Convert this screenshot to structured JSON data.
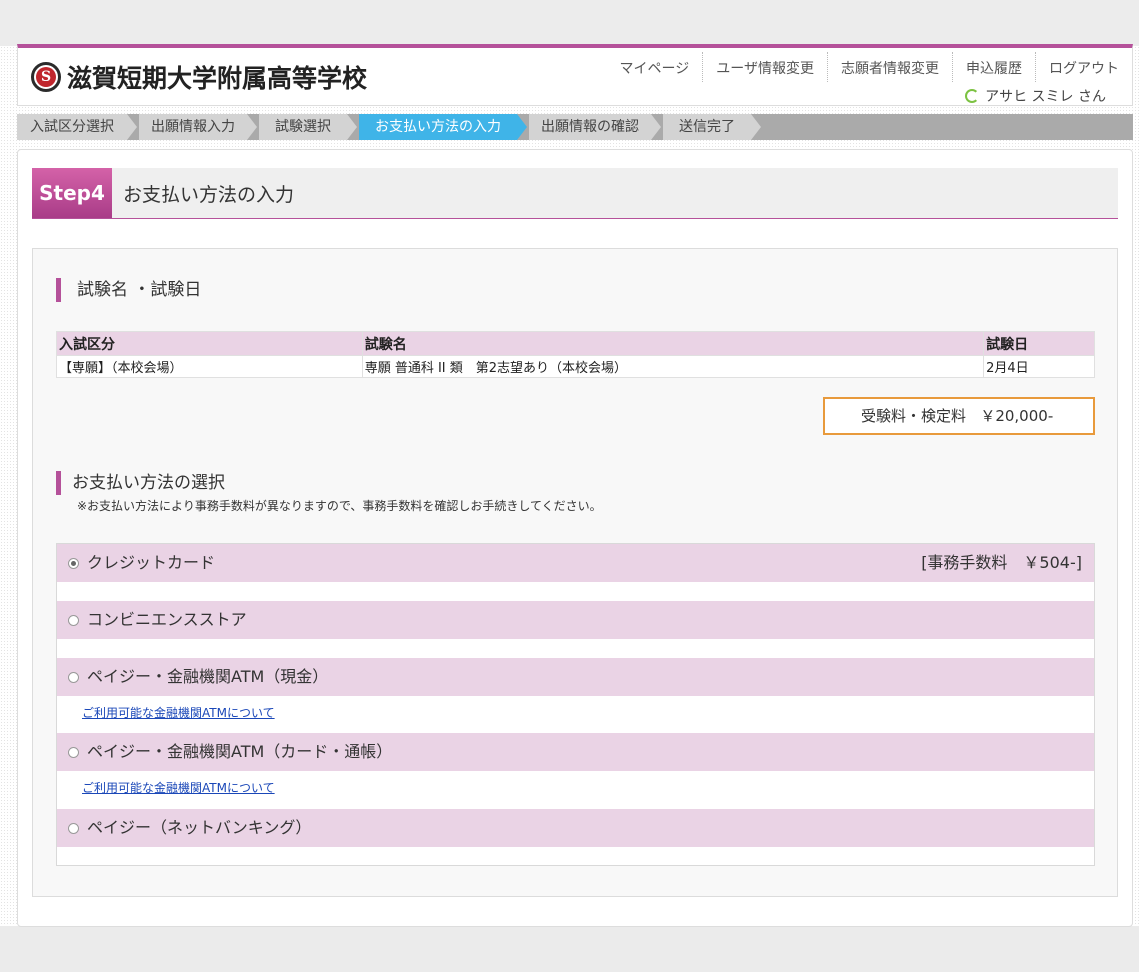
{
  "school": {
    "name": "滋賀短期大学附属高等学校",
    "logo_letter": "S"
  },
  "topnav": [
    "マイページ",
    "ユーザ情報変更",
    "志願者情報変更",
    "申込履歴",
    "ログアウト"
  ],
  "user": {
    "name": "アサヒ スミレ さん"
  },
  "steps": [
    "入試区分選択",
    "出願情報入力",
    "試験選択",
    "お支払い方法の入力",
    "出願情報の確認",
    "送信完了"
  ],
  "active_step": 3,
  "step_header": {
    "badge": "Step4",
    "title": "お支払い方法の入力"
  },
  "exam_section": {
    "title": "試験名 ・試験日",
    "headers": [
      "入試区分",
      "試験名",
      "試験日"
    ],
    "rows": [
      [
        "【専願】（本校会場）",
        "専願 普通科 II 類　第2志望あり（本校会場）",
        "2月4日"
      ]
    ]
  },
  "fee": {
    "label": "受験料・検定料",
    "amount": "￥20,000-"
  },
  "payment_section": {
    "title": "お支払い方法の選択",
    "note": "※お支払い方法により事務手数料が異なりますので、事務手数料を確認しお手続きしてください。",
    "methods": [
      {
        "label": "クレジットカード",
        "fee": "[事務手数料　￥504-]",
        "selected": true
      },
      {
        "label": "コンビニエンスストア",
        "fee": "",
        "selected": false
      },
      {
        "label": "ペイジー・金融機関ATM（現金）",
        "fee": "",
        "selected": false,
        "link": "ご利用可能な金融機関ATMについて"
      },
      {
        "label": "ペイジー・金融機関ATM（カード・通帳）",
        "fee": "",
        "selected": false,
        "link": "ご利用可能な金融機関ATMについて"
      },
      {
        "label": "ペイジー（ネットバンキング）",
        "fee": "",
        "selected": false
      }
    ]
  },
  "colors": {
    "accent": "#b5519a",
    "active_step": "#3fb4e8",
    "fee_border": "#e89a3c",
    "row_bg": "#ead3e5",
    "link": "#1a47b8"
  }
}
